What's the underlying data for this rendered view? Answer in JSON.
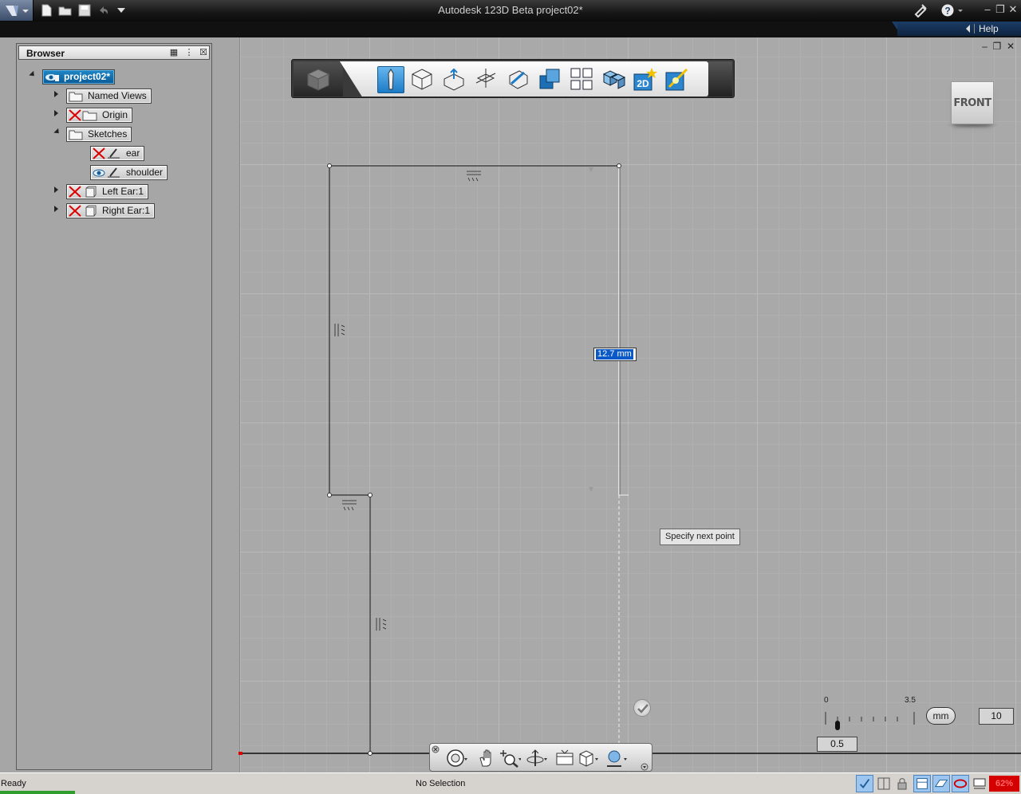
{
  "window": {
    "title": "Autodesk 123D Beta   project02*"
  },
  "helpbar": {
    "help_label": "Help"
  },
  "browser": {
    "title": "Browser",
    "items": [
      {
        "label": "project02*",
        "visible": true,
        "selected": true
      },
      {
        "label": "Named Views",
        "visible": null
      },
      {
        "label": "Origin",
        "visible": false
      },
      {
        "label": "Sketches",
        "visible": null
      },
      {
        "label": "ear",
        "visible": false
      },
      {
        "label": "shoulder",
        "visible": true
      },
      {
        "label": "Left Ear:1",
        "visible": false
      },
      {
        "label": "Right Ear:1",
        "visible": false
      }
    ]
  },
  "viewport": {
    "viewcube_label": "FRONT",
    "dimension_value": "12.7 mm",
    "tooltip": "Specify next point"
  },
  "scale": {
    "min_label": "0",
    "max_label": "3.5",
    "unit": "mm",
    "grid_value": "10",
    "slider_value": "0.5"
  },
  "status": {
    "ready": "Ready",
    "selection": "No Selection",
    "indicator": "62%"
  },
  "colors": {
    "accent_blue": "#1c7bc6",
    "selection_blue": "#0a59c7",
    "viewport_bg": "#a9a9a9",
    "status_red": "#d40000"
  }
}
